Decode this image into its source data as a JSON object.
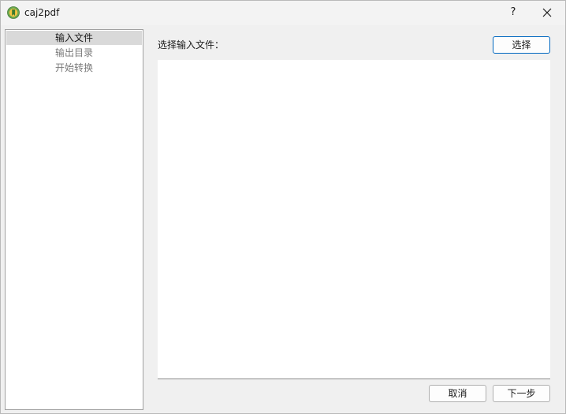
{
  "window": {
    "title": "caj2pdf",
    "help_label": "?"
  },
  "colors": {
    "accent_border": "#0067c0",
    "sidebar_selected_bg": "#d9d9d9",
    "sidebar_inactive_text": "#7a7a7a"
  },
  "icons": {
    "app": "app-logo-icon",
    "close": "close-icon"
  },
  "sidebar": {
    "items": [
      {
        "label": "输入文件",
        "state": "active"
      },
      {
        "label": "输出目录",
        "state": "inactive"
      },
      {
        "label": "开始转换",
        "state": "inactive"
      }
    ]
  },
  "main": {
    "select_label": "选择输入文件：",
    "select_button": "选择"
  },
  "footer": {
    "cancel_button": "取消",
    "next_button": "下一步"
  }
}
